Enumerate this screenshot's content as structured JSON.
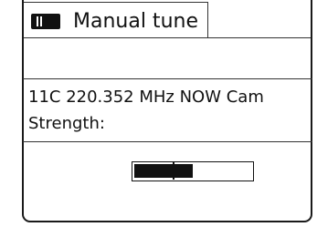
{
  "header": {
    "icon": "radio-mode-icon",
    "title": "Manual tune"
  },
  "tuning": {
    "line1": "11C 220.352 MHz NOW Cam",
    "line2": "Strength:"
  },
  "signal": {
    "strength_fraction": 0.5
  }
}
